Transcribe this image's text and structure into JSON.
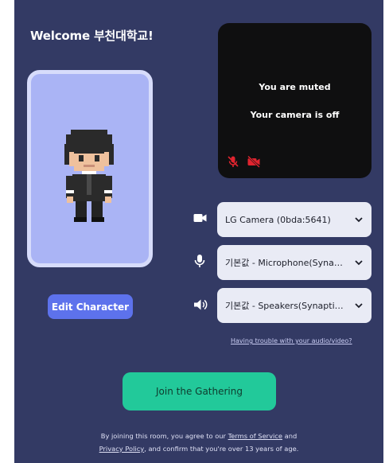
{
  "welcome": "Welcome 부천대학교!",
  "avatar": {
    "edit_label": "Edit Character"
  },
  "video": {
    "muted_text": "You are muted",
    "camera_text": "Your camera is off",
    "mic_icon": "mic-off-icon",
    "cam_icon": "camera-off-icon"
  },
  "devices": {
    "camera": "LG Camera (0bda:5641)",
    "microphone": "기본값 - Microphone(Synaptics...",
    "speaker": "기본값 - Speakers(Synaptics..."
  },
  "help_link": "Having trouble with your audio/video?",
  "join_label": "Join the Gathering",
  "legal": {
    "prefix": "By joining this room, you agree to our",
    "terms": "Terms of Service",
    "and": "and",
    "privacy": "Privacy Policy",
    "suffix": ", and confirm that you're over 13 years of age."
  },
  "colors": {
    "background": "#333a64",
    "accent": "#5d72ec",
    "join": "#22c99a",
    "muted_icon": "#e0242f"
  }
}
